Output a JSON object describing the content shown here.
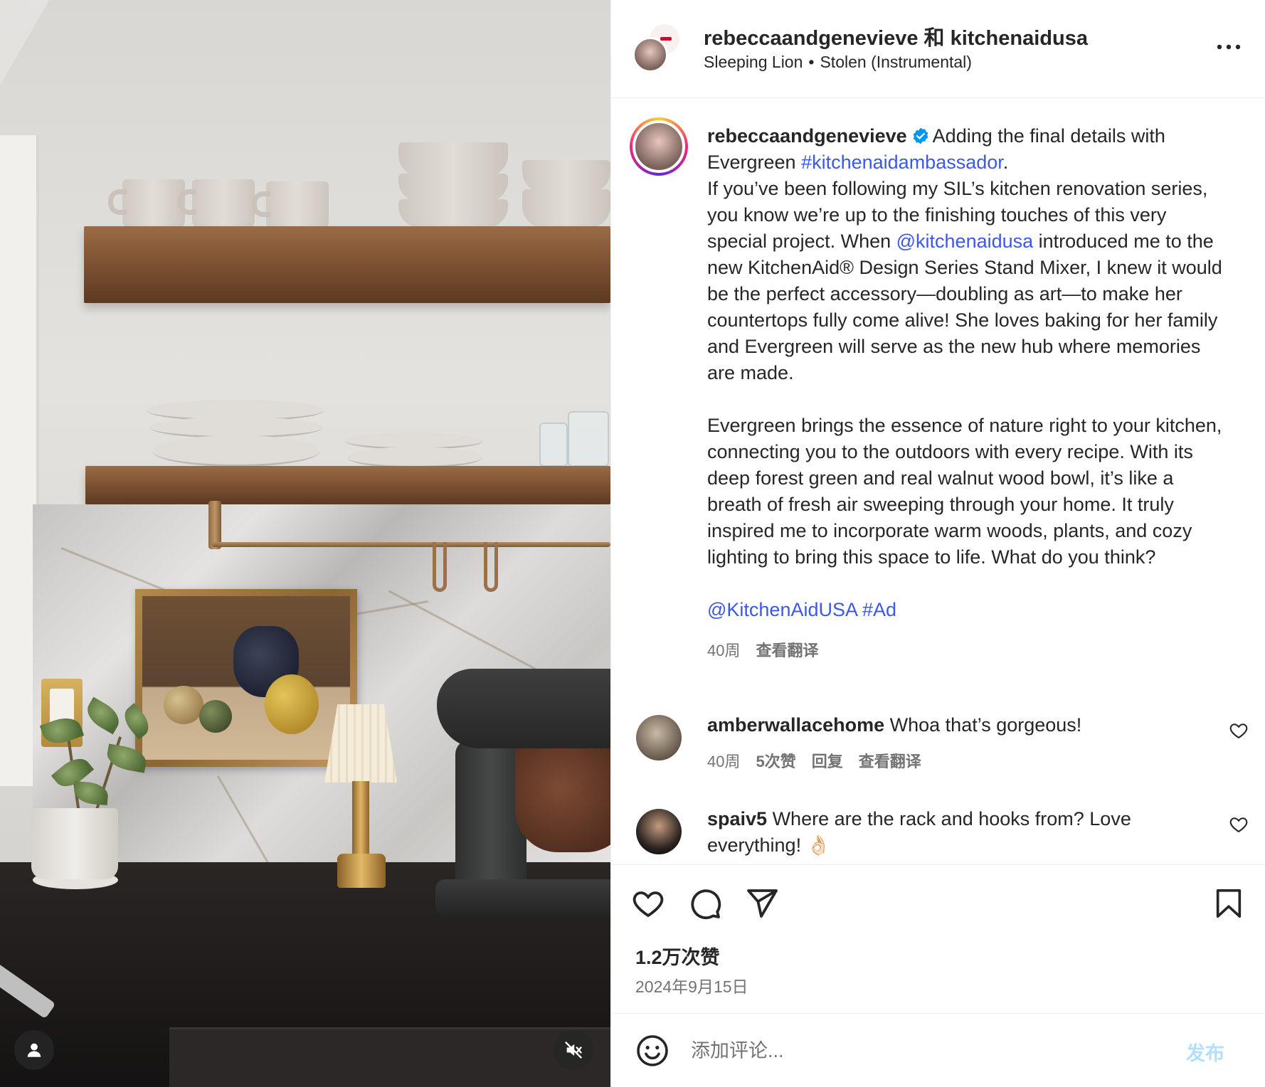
{
  "header": {
    "title": "rebeccaandgenevieve 和 kitchenaidusa",
    "audio_artist": "Sleeping Lion",
    "audio_separator": "•",
    "audio_track": "Stolen (Instrumental)"
  },
  "caption": {
    "username": "rebeccaandgenevieve",
    "line1_text": "Adding the final details with Evergreen ",
    "hashtag1": "#kitchenaidambassador",
    "line1_end": ".",
    "para1_before_mention": "If you’ve been following my SIL’s kitchen renovation series, you know we’re up to the finishing touches of this very special project. When ",
    "mention1": "@kitchenaidusa",
    "para1_after_mention": " introduced me to the new KitchenAid® Design Series Stand Mixer, I knew it would be the perfect accessory—doubling as art—to make her countertops fully come alive! She loves baking for her family and Evergreen will serve as the new hub where memories are made.",
    "para2": "Evergreen brings the essence of nature right to your kitchen, connecting you to the outdoors with every recipe. With its deep forest green and real walnut wood bowl, it’s like a breath of fresh air sweeping through your home. It truly inspired me to incorporate warm woods, plants, and cozy lighting to bring this space to life. What do you think?",
    "mention2": "@KitchenAidUSA",
    "hashtag2": "#Ad",
    "time": "40周",
    "translate": "查看翻译"
  },
  "comments": [
    {
      "username": "amberwallacehome",
      "text": "Whoa that’s gorgeous!",
      "time": "40周",
      "likes": "5次赞",
      "reply": "回复",
      "translate": "查看翻译"
    },
    {
      "username": "spaiv5",
      "text": "Where are the rack and hooks from? Love everything! 👌🏻"
    }
  ],
  "actions": {
    "likes_count": "1.2万次赞",
    "date": "2024年9月15日"
  },
  "comment_bar": {
    "placeholder": "添加评论...",
    "post_label": "发布"
  },
  "colors": {
    "link": "#3c58e8",
    "verified": "#0095f6",
    "post_disabled": "#b2dffc",
    "secondary_text": "#737373"
  },
  "icons": {
    "more": "more-horizontal-icon",
    "like": "heart-icon",
    "comment": "comment-bubble-icon",
    "share": "paper-plane-icon",
    "save": "bookmark-icon",
    "emoji": "smiley-icon",
    "mute": "speaker-muted-icon",
    "tagged_user": "user-icon"
  }
}
